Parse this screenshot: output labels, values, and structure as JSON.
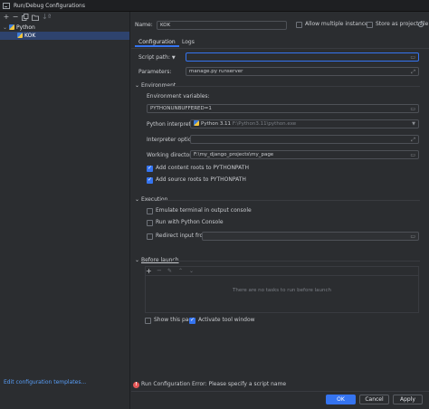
{
  "window": {
    "title": "Run/Debug Configurations"
  },
  "toolbar": {
    "add": "+",
    "remove": "−"
  },
  "tree": {
    "group_label": "Python",
    "item_label": "KOK"
  },
  "left_footer": {
    "link": "Edit configuration templates..."
  },
  "header": {
    "name_label": "Name:",
    "name_value": "KOK",
    "allow_multiple": "Allow multiple instances",
    "store_as_file": "Store as project file"
  },
  "tabs": [
    "Configuration",
    "Logs"
  ],
  "config": {
    "script_path_label": "Script path:",
    "script_path_value": "",
    "parameters_label": "Parameters:",
    "parameters_value": "manage.py runserver",
    "environment_section": "Environment",
    "env_vars_label": "Environment variables:",
    "env_vars_value": "PYTHONUNBUFFERED=1",
    "interpreter_label": "Python interpreter:",
    "interpreter_value": "Python 3.11",
    "interpreter_path": "F:\\Python3.11\\python.exe",
    "interp_options_label": "Interpreter options:",
    "interp_options_value": "",
    "workdir_label": "Working directory:",
    "workdir_value": "F:\\my_django_projects\\my_page",
    "add_content_roots": "Add content roots to PYTHONPATH",
    "add_source_roots": "Add source roots to PYTHONPATH",
    "execution_section": "Execution",
    "emulate_terminal": "Emulate terminal in output console",
    "run_with_console": "Run with Python Console",
    "redirect_input": "Redirect input from:",
    "redirect_input_value": "",
    "before_launch_section": "Before launch",
    "no_tasks": "There are no tasks to run before launch",
    "show_this_page": "Show this page",
    "activate_tool_window": "Activate tool window"
  },
  "error": {
    "text": "Run Configuration Error: Please specify a script name"
  },
  "buttons": {
    "ok": "OK",
    "cancel": "Cancel",
    "apply": "Apply"
  },
  "colors": {
    "accent": "#3574f0",
    "error": "#e55757",
    "selection": "#2e436e"
  }
}
